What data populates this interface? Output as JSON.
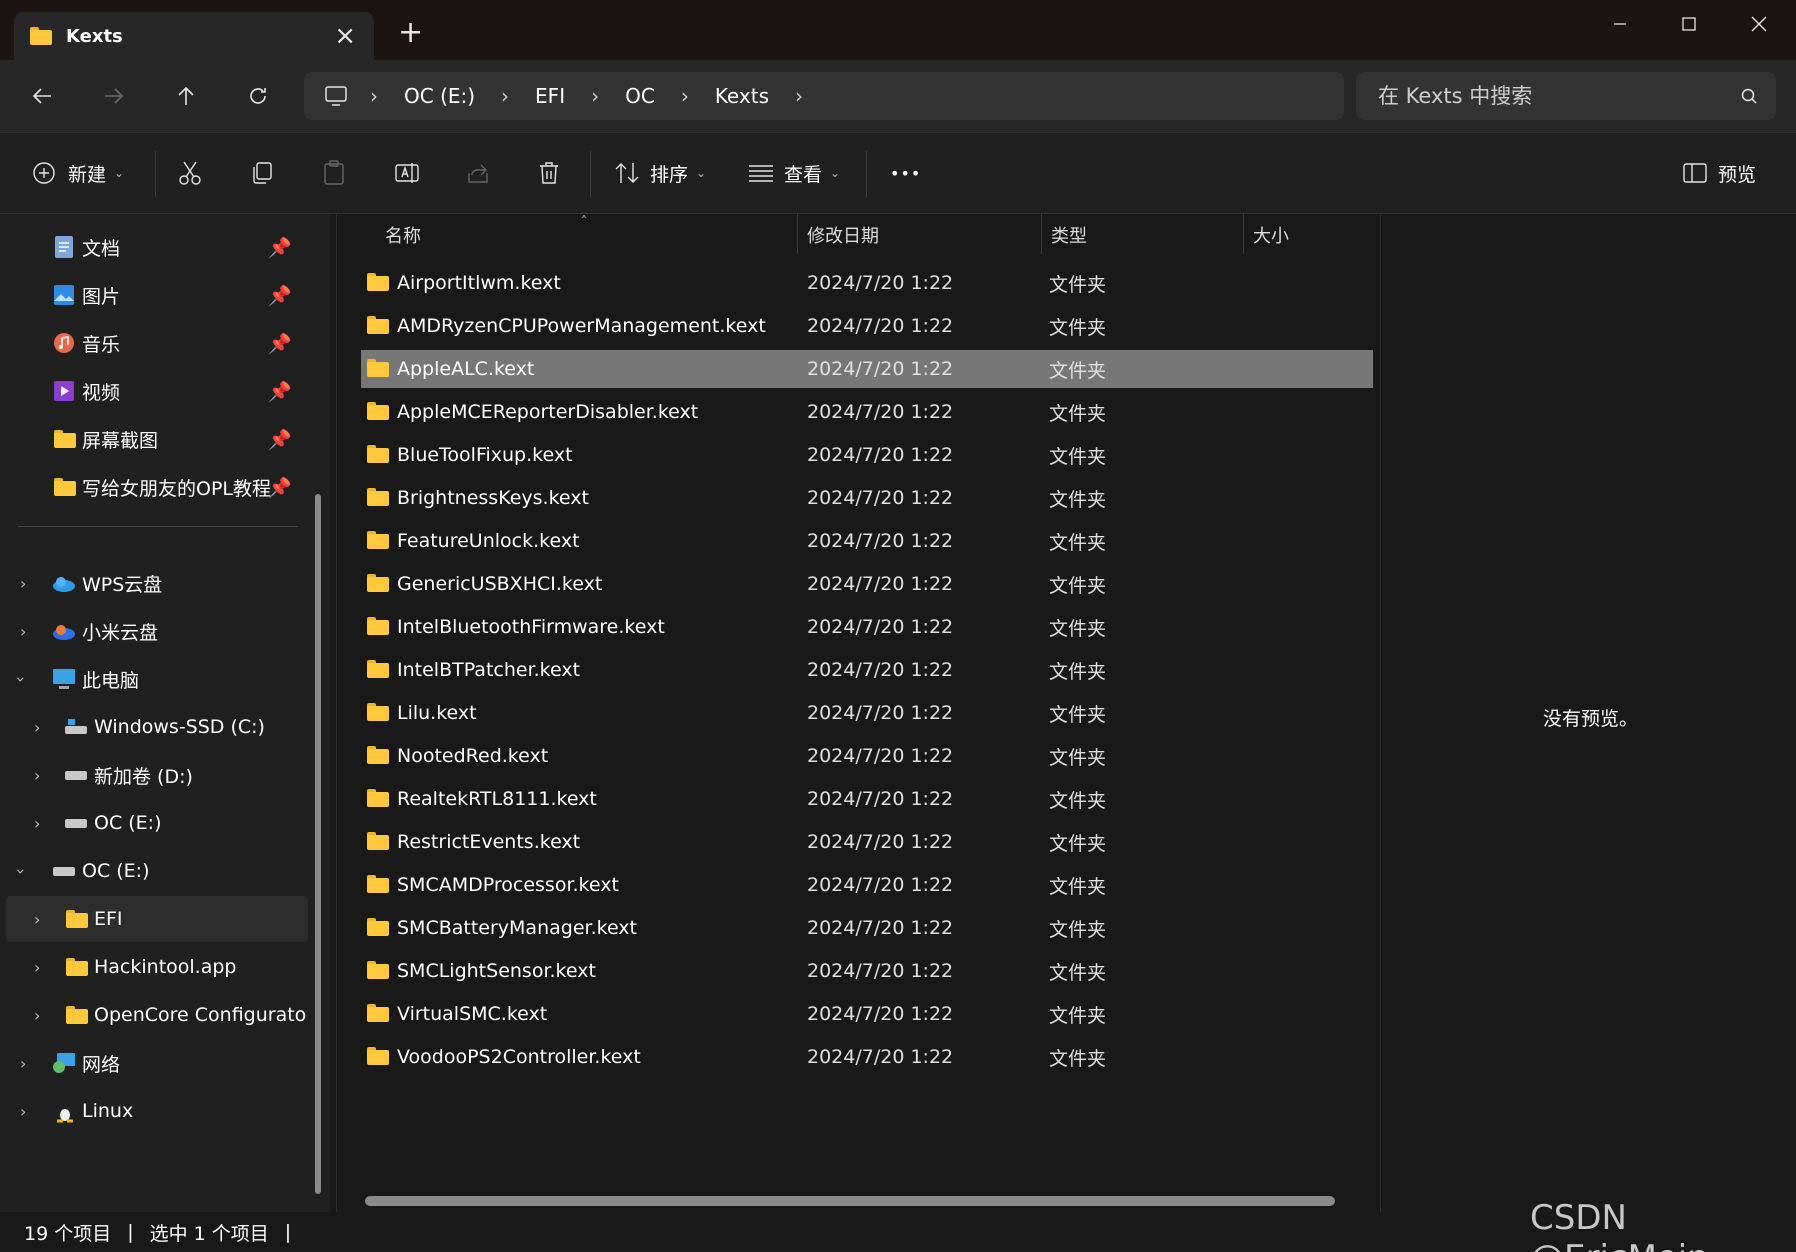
{
  "window": {
    "tab_title": "Kexts",
    "new_tab": "+",
    "controls": {
      "minimize": "minimize-icon",
      "maximize": "maximize-icon",
      "close": "close-icon"
    }
  },
  "nav": {
    "crumbs": [
      "OC (E:)",
      "EFI",
      "OC",
      "Kexts"
    ],
    "search_placeholder": "在 Kexts 中搜索"
  },
  "toolbar": {
    "new_label": "新建",
    "sort_label": "排序",
    "view_label": "查看",
    "more_label": "•••",
    "preview_label": "预览"
  },
  "sidebar": {
    "pinned": [
      {
        "label": "文档",
        "icon": "document-icon"
      },
      {
        "label": "图片",
        "icon": "pictures-icon"
      },
      {
        "label": "音乐",
        "icon": "music-icon"
      },
      {
        "label": "视频",
        "icon": "videos-icon"
      },
      {
        "label": "屏幕截图",
        "icon": "folder-icon"
      },
      {
        "label": "写给女朋友的OPL教程",
        "icon": "folder-icon"
      }
    ],
    "tree": [
      {
        "label": "WPS云盘",
        "icon": "cloud-icon"
      },
      {
        "label": "小米云盘",
        "icon": "cloud-icon"
      },
      {
        "label": "此电脑",
        "icon": "computer-icon"
      },
      {
        "label": "Windows-SSD (C:)",
        "icon": "drive-icon"
      },
      {
        "label": "新加卷 (D:)",
        "icon": "drive-icon"
      },
      {
        "label": "OC (E:)",
        "icon": "drive-icon"
      },
      {
        "label": "OC (E:)",
        "icon": "drive-icon"
      },
      {
        "label": "EFI",
        "icon": "folder-icon"
      },
      {
        "label": "Hackintool.app",
        "icon": "folder-icon"
      },
      {
        "label": "OpenCore Configurator.a",
        "icon": "folder-icon"
      },
      {
        "label": "网络",
        "icon": "network-icon"
      },
      {
        "label": "Linux",
        "icon": "linux-icon"
      }
    ]
  },
  "columns": {
    "name": "名称",
    "date": "修改日期",
    "type": "类型",
    "size": "大小"
  },
  "files": [
    {
      "name": "AirportItlwm.kext",
      "date": "2024/7/20 1:22",
      "type": "文件夹"
    },
    {
      "name": "AMDRyzenCPUPowerManagement.kext",
      "date": "2024/7/20 1:22",
      "type": "文件夹"
    },
    {
      "name": "AppleALC.kext",
      "date": "2024/7/20 1:22",
      "type": "文件夹"
    },
    {
      "name": "AppleMCEReporterDisabler.kext",
      "date": "2024/7/20 1:22",
      "type": "文件夹"
    },
    {
      "name": "BlueToolFixup.kext",
      "date": "2024/7/20 1:22",
      "type": "文件夹"
    },
    {
      "name": "BrightnessKeys.kext",
      "date": "2024/7/20 1:22",
      "type": "文件夹"
    },
    {
      "name": "FeatureUnlock.kext",
      "date": "2024/7/20 1:22",
      "type": "文件夹"
    },
    {
      "name": "GenericUSBXHCI.kext",
      "date": "2024/7/20 1:22",
      "type": "文件夹"
    },
    {
      "name": "IntelBluetoothFirmware.kext",
      "date": "2024/7/20 1:22",
      "type": "文件夹"
    },
    {
      "name": "IntelBTPatcher.kext",
      "date": "2024/7/20 1:22",
      "type": "文件夹"
    },
    {
      "name": "Lilu.kext",
      "date": "2024/7/20 1:22",
      "type": "文件夹"
    },
    {
      "name": "NootedRed.kext",
      "date": "2024/7/20 1:22",
      "type": "文件夹"
    },
    {
      "name": "RealtekRTL8111.kext",
      "date": "2024/7/20 1:22",
      "type": "文件夹"
    },
    {
      "name": "RestrictEvents.kext",
      "date": "2024/7/20 1:22",
      "type": "文件夹"
    },
    {
      "name": "SMCAMDProcessor.kext",
      "date": "2024/7/20 1:22",
      "type": "文件夹"
    },
    {
      "name": "SMCBatteryManager.kext",
      "date": "2024/7/20 1:22",
      "type": "文件夹"
    },
    {
      "name": "SMCLightSensor.kext",
      "date": "2024/7/20 1:22",
      "type": "文件夹"
    },
    {
      "name": "VirtualSMC.kext",
      "date": "2024/7/20 1:22",
      "type": "文件夹"
    },
    {
      "name": "VoodooPS2Controller.kext",
      "date": "2024/7/20 1:22",
      "type": "文件夹"
    }
  ],
  "preview": {
    "empty_text": "没有预览。"
  },
  "status": {
    "item_count": "19 个项目",
    "selected": "选中 1 个项目",
    "sep": "|"
  },
  "watermark": "CSDN @EricMoin"
}
